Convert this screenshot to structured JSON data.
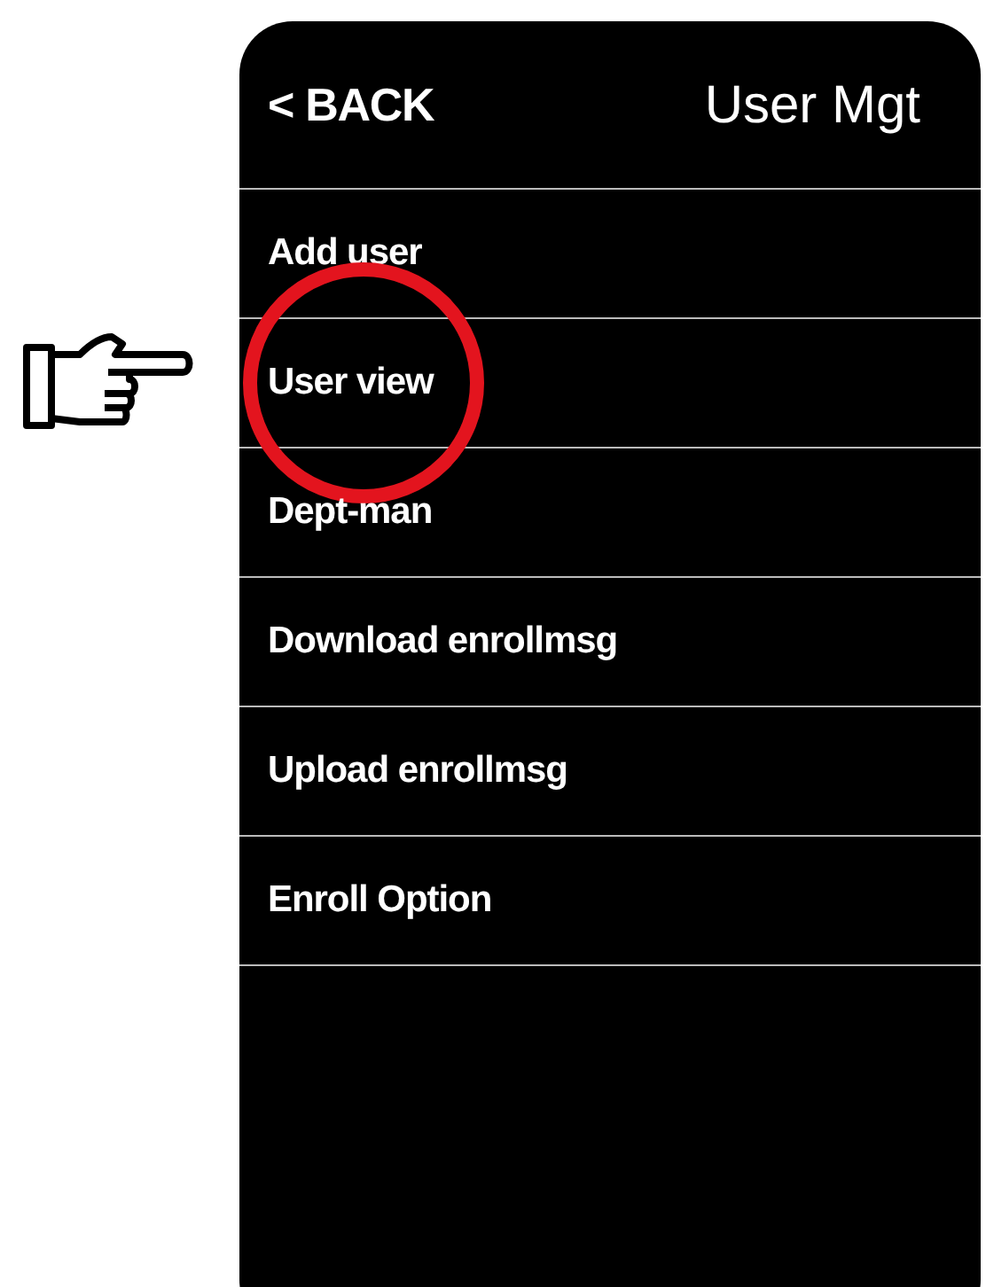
{
  "header": {
    "back": "< BACK",
    "title": "User Mgt"
  },
  "menu": [
    {
      "label": "Add user",
      "highlighted": false
    },
    {
      "label": "User view",
      "highlighted": true
    },
    {
      "label": "Dept-man",
      "highlighted": false
    },
    {
      "label": "Download enrollmsg",
      "highlighted": false
    },
    {
      "label": "Upload enrollmsg",
      "highlighted": false
    },
    {
      "label": "Enroll Option",
      "highlighted": false
    }
  ]
}
